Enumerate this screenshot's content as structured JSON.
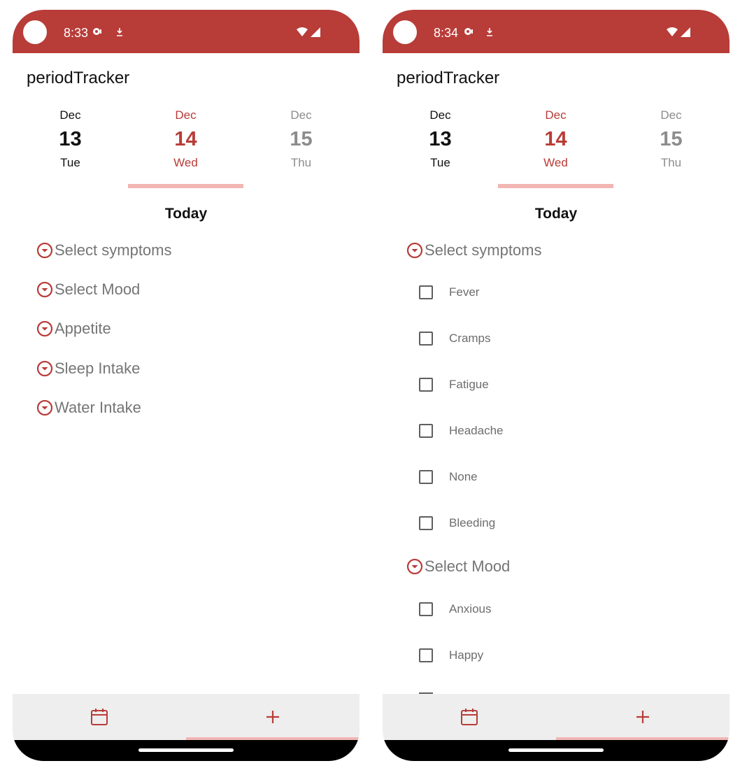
{
  "colors": {
    "primary": "#b83c38",
    "indicator": "#f2b6b4",
    "nav_bg": "#eeeeee"
  },
  "left": {
    "status": {
      "time": "8:33"
    },
    "app_title": "periodTracker",
    "dates": [
      {
        "month": "Dec",
        "day": "13",
        "weekday": "Tue"
      },
      {
        "month": "Dec",
        "day": "14",
        "weekday": "Wed"
      },
      {
        "month": "Dec",
        "day": "15",
        "weekday": "Thu"
      }
    ],
    "today_label": "Today",
    "sections": [
      "Select symptoms",
      "Select Mood",
      "Appetite",
      "Sleep Intake",
      "Water Intake"
    ],
    "nav": {
      "calendar_icon": "calendar-icon",
      "add_icon": "plus-icon"
    }
  },
  "right": {
    "status": {
      "time": "8:34"
    },
    "app_title": "periodTracker",
    "dates": [
      {
        "month": "Dec",
        "day": "13",
        "weekday": "Tue"
      },
      {
        "month": "Dec",
        "day": "14",
        "weekday": "Wed"
      },
      {
        "month": "Dec",
        "day": "15",
        "weekday": "Thu"
      }
    ],
    "today_label": "Today",
    "symptoms_header": "Select symptoms",
    "symptoms": [
      "Fever",
      "Cramps",
      "Fatigue",
      "Headache",
      "None",
      "Bleeding"
    ],
    "mood_header": "Select Mood",
    "moods": [
      "Anxious",
      "Happy"
    ],
    "nav": {
      "calendar_icon": "calendar-icon",
      "add_icon": "plus-icon"
    }
  }
}
